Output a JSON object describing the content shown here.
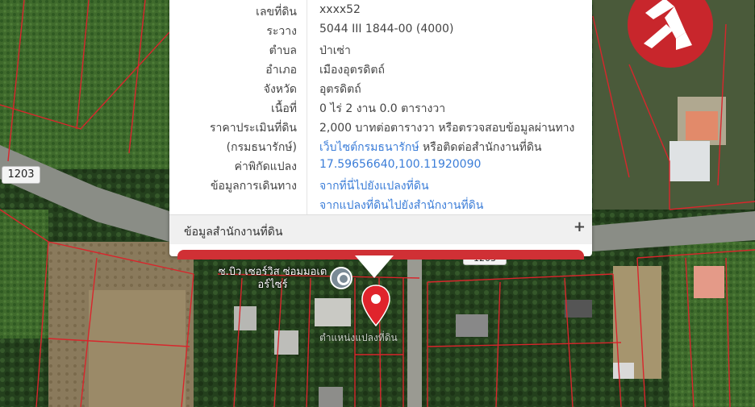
{
  "info_rows": [
    {
      "label": "เลขที่ดิน",
      "value": "xxxx52",
      "link": false
    },
    {
      "label": "ระวาง",
      "value": "5044 III 1844-00 (4000)",
      "link": false
    },
    {
      "label": "ตำบล",
      "value": "ป่าเซ่า",
      "link": false
    },
    {
      "label": "อำเภอ",
      "value": "เมืองอุตรดิตถ์",
      "link": false
    },
    {
      "label": "จังหวัด",
      "value": "อุตรดิตถ์",
      "link": false
    },
    {
      "label": "เนื้อที่",
      "value": "0 ไร่ 2 งาน 0.0 ตารางวา",
      "link": false
    },
    {
      "label": "ราคาประเมินที่ดิน",
      "value": "2,000 บาทต่อตารางวา หรือตรวจสอบข้อมูลผ่านทาง",
      "link": false
    },
    {
      "label": "(กรมธนารักษ์)",
      "value_link": "เว็บไซต์กรมธนารักษ์",
      "value_rest": " หรือติดต่อสำนักงานที่ดิน",
      "link": "mixed"
    },
    {
      "label": "ค่าพิกัดแปลง",
      "value": "17.59656640,100.11920090",
      "link": true
    },
    {
      "label": "ข้อมูลการเดินทาง",
      "value": "จากที่นี่ไปยังแปลงที่ดิน",
      "link": true
    },
    {
      "label": "",
      "value": "จากแปลงที่ดินไปยังสำนักงานที่ดิน",
      "link": true
    }
  ],
  "office_section": {
    "label": "ข้อมูลสำนักงานที่ดิน",
    "toggle": "+"
  },
  "map": {
    "road_badge": "1203",
    "road_badge2": "1203",
    "poi_name": "ซ.บิว เซอร์วิส ซ่อมมอเตอร์ไซร์",
    "parcel_label": "ตำแหน่งแปลงที่ดิน",
    "pin_color": "#e0242c",
    "boundary_color": "#d8262c"
  },
  "logo": {
    "color": "#c8262c",
    "icon": "brand-logo-icon"
  }
}
